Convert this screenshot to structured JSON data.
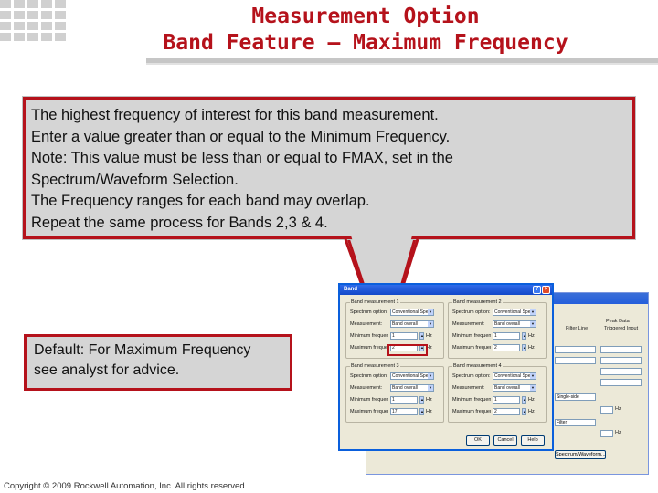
{
  "title": {
    "line1": "Measurement Option",
    "line2": "Band Feature – Maximum Frequency"
  },
  "callout": {
    "lines": [
      "The highest frequency of interest for this band measurement.",
      "Enter a value greater than or equal to the Minimum Frequency.",
      "Note: This value must be less than or equal to FMAX, set in the",
      "Spectrum/Waveform Selection.",
      "The Frequency ranges for each band may overlap.",
      " Repeat the same process for Bands 2,3 & 4."
    ]
  },
  "note": {
    "lines": [
      "Default: For Maximum Frequency",
      "see analyst for advice."
    ]
  },
  "copyright": "Copyright © 2009 Rockwell Automation, Inc. All rights reserved.",
  "dialog": {
    "title": "Band",
    "groups": [
      {
        "label": "Band measurement 1",
        "rows": [
          {
            "label": "Spectrum option:",
            "value": "Conventional Spectr"
          },
          {
            "label": "Measurement:",
            "value": "Band overall"
          },
          {
            "label": "Minimum frequency:",
            "value": "1",
            "unit": "Hz"
          },
          {
            "label": "Maximum frequency:",
            "value": "2",
            "unit": "Hz"
          }
        ]
      },
      {
        "label": "Band measurement 2",
        "rows": [
          {
            "label": "Spectrum option:",
            "value": "Conventional Spectr"
          },
          {
            "label": "Measurement:",
            "value": "Band overall"
          },
          {
            "label": "Minimum frequency:",
            "value": "1",
            "unit": "Hz"
          },
          {
            "label": "Maximum frequency:",
            "value": "2",
            "unit": "Hz"
          }
        ]
      },
      {
        "label": "Band measurement 3",
        "rows": [
          {
            "label": "Spectrum option:",
            "value": "Conventional Spectr"
          },
          {
            "label": "Measurement:",
            "value": "Band overall"
          },
          {
            "label": "Minimum frequency:",
            "value": "1",
            "unit": "Hz"
          },
          {
            "label": "Maximum frequency:",
            "value": "17",
            "unit": "Hz"
          }
        ]
      },
      {
        "label": "Band measurement 4",
        "rows": [
          {
            "label": "Spectrum option:",
            "value": "Conventional Spectr"
          },
          {
            "label": "Measurement:",
            "value": "Band overall"
          },
          {
            "label": "Minimum frequency:",
            "value": "1",
            "unit": "Hz"
          },
          {
            "label": "Maximum frequency:",
            "value": "2",
            "unit": "Hz"
          }
        ]
      }
    ],
    "buttons": [
      "OK",
      "Cancel",
      "Help"
    ]
  },
  "background_window": {
    "column_headers": [
      "Filter Line",
      "Triggered Input",
      "Peak Data"
    ],
    "fields": [
      "Hz",
      "Hz"
    ],
    "selects": [
      "Single-side",
      "Filter"
    ],
    "button": "Spectrum/Waveform..."
  },
  "colors": {
    "title_red": "#b5121b",
    "callout_bg": "#d5d5d5",
    "dialog_bg": "#ece9d8",
    "titlebar_blue": "#1248c9"
  }
}
